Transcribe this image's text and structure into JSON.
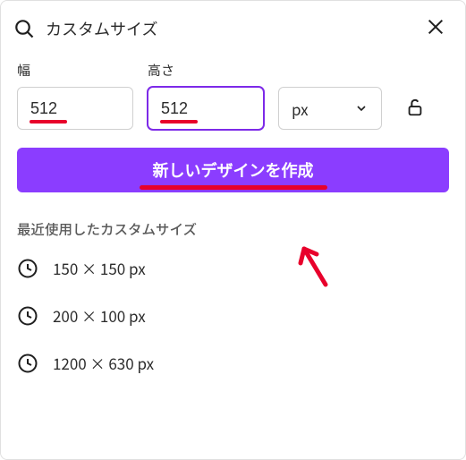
{
  "search": {
    "text": "カスタムサイズ"
  },
  "labels": {
    "width": "幅",
    "height": "高さ"
  },
  "inputs": {
    "width_value": "512",
    "height_value": "512",
    "unit": "px"
  },
  "create_button": "新しいデザインを作成",
  "recent": {
    "title": "最近使用したカスタムサイズ",
    "items": [
      "150 × 150 px",
      "200 × 100 px",
      "1200 × 630 px"
    ]
  },
  "colors": {
    "accent": "#8b3dff",
    "annotation": "#e8002b"
  }
}
